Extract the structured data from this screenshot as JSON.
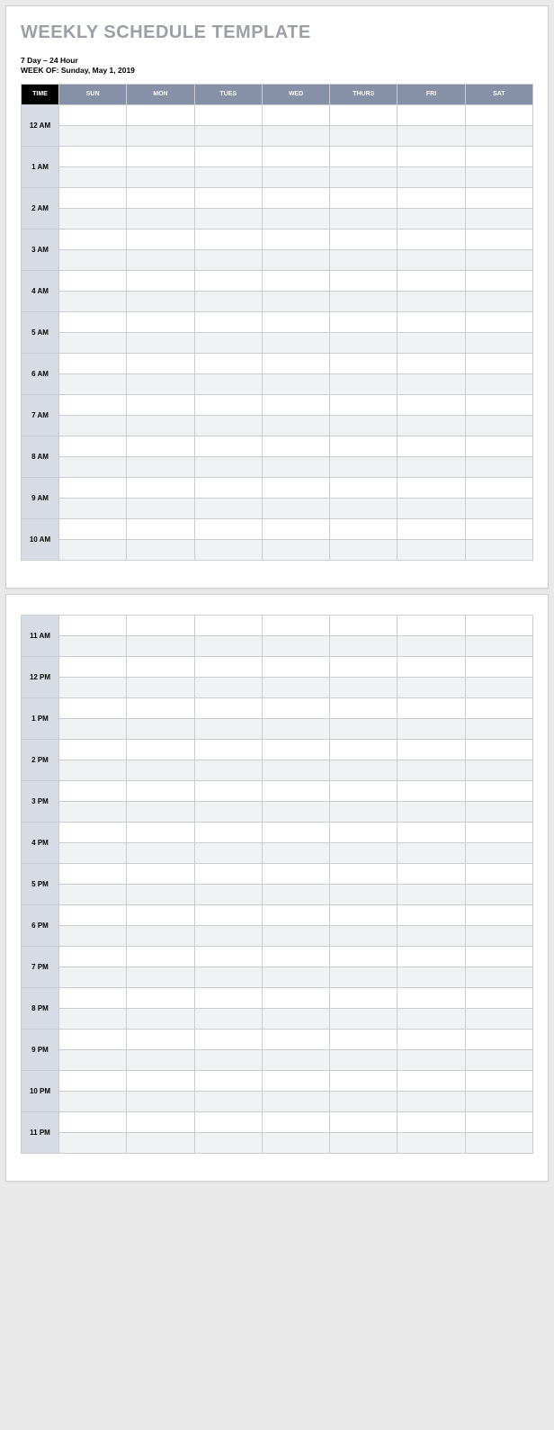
{
  "title": "WEEKLY SCHEDULE TEMPLATE",
  "subtitle_line1": "7 Day – 24 Hour",
  "subtitle_line2_prefix": "WEEK OF: ",
  "week_of": "Sunday, May 1, 2019",
  "header_time": "TIME",
  "days": [
    "SUN",
    "MON",
    "TUES",
    "WED",
    "THURS",
    "FRI",
    "SAT"
  ],
  "page1_hours": [
    "12 AM",
    "1 AM",
    "2 AM",
    "3 AM",
    "4 AM",
    "5 AM",
    "6 AM",
    "7 AM",
    "8 AM",
    "9 AM",
    "10 AM"
  ],
  "page2_hours": [
    "11 AM",
    "12 PM",
    "1 PM",
    "2 PM",
    "3 PM",
    "4 PM",
    "5 PM",
    "6 PM",
    "7 PM",
    "8 PM",
    "9 PM",
    "10 PM",
    "11 PM"
  ]
}
